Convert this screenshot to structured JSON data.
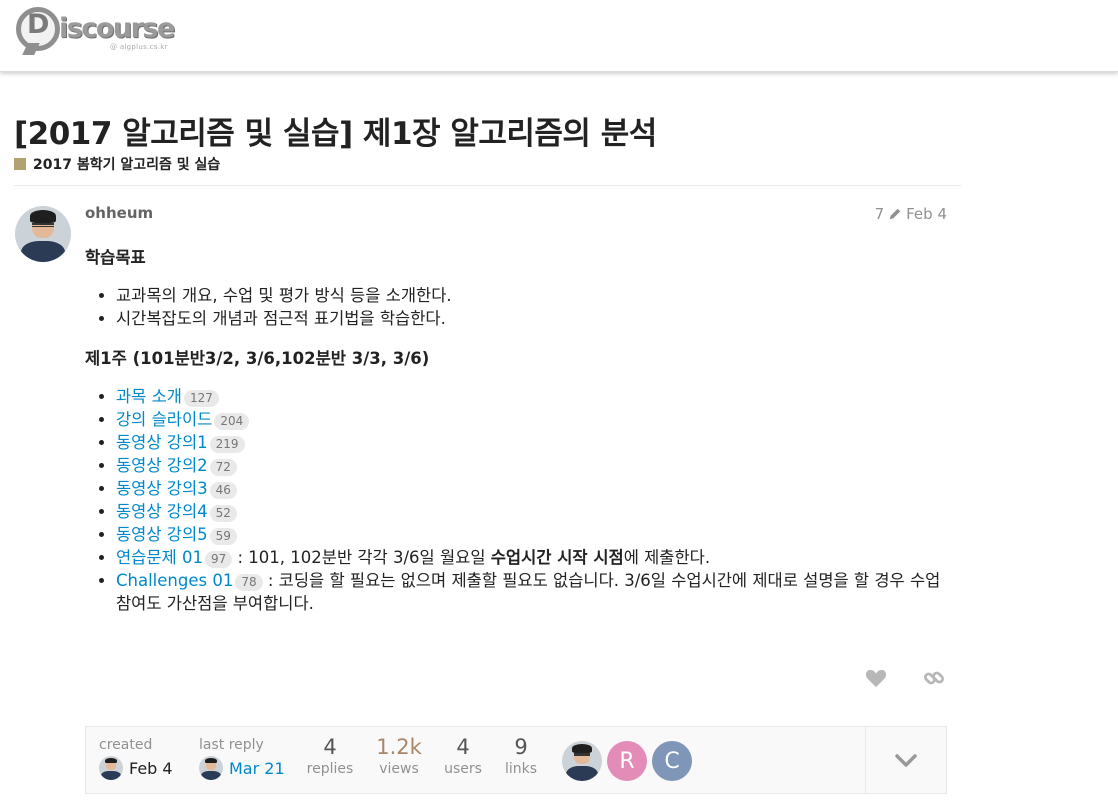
{
  "header": {
    "logo_text": "iscourse",
    "logo_letter": "D",
    "logo_subtitle": "@ algplus.cs.kr"
  },
  "topic": {
    "title": "[2017 알고리즘 및 실습] 제1장 알고리즘의 분석",
    "category": "2017 봄학기 알고리즘 및 실습",
    "category_color": "#b3a173"
  },
  "post": {
    "username": "ohheum",
    "edit_count": "7",
    "date": "Feb 4",
    "heading1": "학습목표",
    "objectives": [
      "교과목의 개요, 수업 및 평가 방식 등을 소개한다.",
      "시간복잡도의 개념과 점근적 표기법을 학습한다."
    ],
    "heading2": "제1주 (101분반3/2, 3/6,102분반 3/3, 3/6)",
    "links": [
      {
        "label": "과목 소개",
        "clicks": "127"
      },
      {
        "label": "강의 슬라이드",
        "clicks": "204"
      },
      {
        "label": "동영상 강의1",
        "clicks": "219"
      },
      {
        "label": "동영상 강의2",
        "clicks": "72"
      },
      {
        "label": "동영상 강의3",
        "clicks": "46"
      },
      {
        "label": "동영상 강의4",
        "clicks": "52"
      },
      {
        "label": "동영상 강의5",
        "clicks": "59"
      }
    ],
    "exercise": {
      "label": "연습문제 01",
      "clicks": "97",
      "text_before": " : 101, 102분반 각각 3/6일 월요일 ",
      "text_bold": "수업시간 시작 시점",
      "text_after": "에 제출한다."
    },
    "challenge": {
      "label": "Challenges 01",
      "clicks": "78",
      "text": " : 코딩을 할 필요는 없으며 제출할 필요도 없습니다. 3/6일 수업시간에 제대로 설명을 할 경우 수업참여도 가산점을 부여합니다."
    }
  },
  "topic_map": {
    "created_label": "created",
    "created_date": "Feb 4",
    "last_reply_label": "last reply",
    "last_reply_date": "Mar 21",
    "stats": [
      {
        "num": "4",
        "label": "replies"
      },
      {
        "num": "1.2k",
        "label": "views"
      },
      {
        "num": "4",
        "label": "users"
      },
      {
        "num": "9",
        "label": "links"
      }
    ],
    "participants": [
      {
        "letter": "R",
        "color": "#e38cb8"
      },
      {
        "letter": "C",
        "color": "#8096b8"
      }
    ],
    "views_color": "#a98668"
  }
}
